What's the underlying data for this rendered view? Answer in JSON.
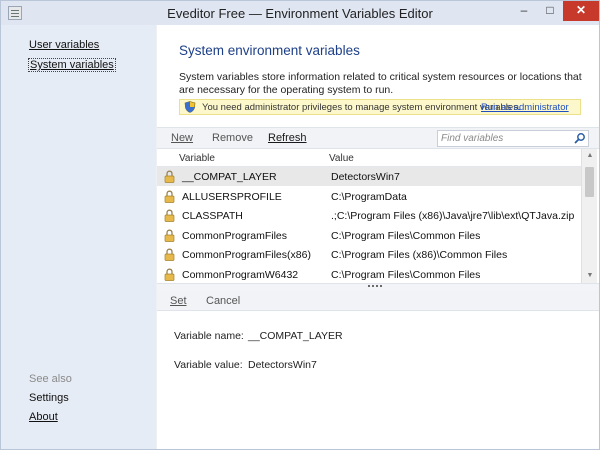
{
  "window": {
    "title": "Eveditor Free — Environment Variables Editor",
    "controls": {
      "minimize": "–",
      "maximize": "□",
      "close": "✕"
    }
  },
  "sidebar": {
    "items": [
      {
        "label": "User variables"
      },
      {
        "label": "System variables"
      }
    ],
    "see_also_label": "See also",
    "footer_items": [
      {
        "label": "Settings"
      },
      {
        "label": "About"
      }
    ]
  },
  "main": {
    "heading": "System environment variables",
    "description": "System variables store information related to critical system resources or locations that are necessary for the operating system to run.",
    "warning": {
      "text": "You need administrator privileges to manage system environment variables.",
      "link": "Run as administrator"
    }
  },
  "toolbar": {
    "new_label": "New",
    "remove_label": "Remove",
    "refresh_label": "Refresh",
    "search_placeholder": "Find variables"
  },
  "table": {
    "columns": {
      "name": "Variable",
      "value": "Value"
    },
    "rows": [
      {
        "name": "__COMPAT_LAYER",
        "value": "DetectorsWin7"
      },
      {
        "name": "ALLUSERSPROFILE",
        "value": "C:\\ProgramData"
      },
      {
        "name": "CLASSPATH",
        "value": ".;C:\\Program Files (x86)\\Java\\jre7\\lib\\ext\\QTJava.zip"
      },
      {
        "name": "CommonProgramFiles",
        "value": "C:\\Program Files\\Common Files"
      },
      {
        "name": "CommonProgramFiles(x86)",
        "value": "C:\\Program Files (x86)\\Common Files"
      },
      {
        "name": "CommonProgramW6432",
        "value": "C:\\Program Files\\Common Files"
      }
    ],
    "selected_index": 0
  },
  "detail_toolbar": {
    "set_label": "Set",
    "cancel_label": "Cancel"
  },
  "details": {
    "name_label": "Variable name:",
    "name_value": "__COMPAT_LAYER",
    "value_label": "Variable value:",
    "value_value": "DetectorsWin7"
  },
  "colors": {
    "heading": "#1c3f88",
    "sidebar_bg": "#e6ecf5",
    "warning_bg": "#fdf8cc",
    "link": "#1f4fc0",
    "close_button": "#c7392b"
  }
}
